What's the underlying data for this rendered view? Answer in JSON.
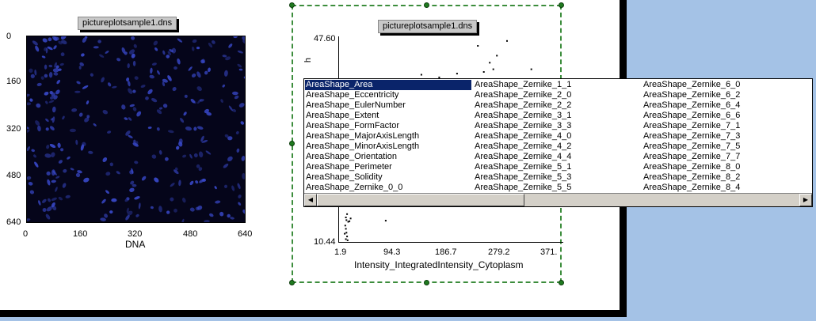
{
  "image_plot": {
    "title": "pictureplotsample1.dns",
    "y_ticks": [
      "0",
      "160",
      "320",
      "480",
      "640"
    ],
    "x_ticks": [
      "0",
      "160",
      "320",
      "480",
      "640"
    ],
    "x_label": "DNA",
    "nucleus_color": "#3848c8"
  },
  "scatter_plot": {
    "title": "pictureplotsample1.dns",
    "y_top": "47.60",
    "y_bottom": "10.44",
    "y_label_fragment": "h",
    "x_ticks": [
      "1.9",
      "94.3",
      "186.7",
      "279.2",
      "371."
    ],
    "x_label": "Intensity_IntegratedIntensity_Cytoplasm"
  },
  "chart_data": {
    "type": "scatter",
    "title": "pictureplotsample1.dns",
    "xlabel": "Intensity_IntegratedIntensity_Cytoplasm",
    "ylabel": "",
    "xlim": [
      1.9,
      371
    ],
    "ylim": [
      10.44,
      47.6
    ],
    "points": [
      [
        230,
        46.3
      ],
      [
        279,
        47.2
      ],
      [
        262,
        44.5
      ],
      [
        250,
        43.2
      ],
      [
        256,
        42.0
      ],
      [
        320,
        42.0
      ],
      [
        240,
        41.5
      ],
      [
        135,
        41.0
      ],
      [
        165,
        40.5
      ],
      [
        195,
        41.2
      ],
      [
        200,
        40.0
      ],
      [
        210,
        39.3
      ],
      [
        145,
        39.0
      ],
      [
        8,
        14.8
      ],
      [
        9,
        14.3
      ],
      [
        10,
        15.4
      ],
      [
        7,
        13.3
      ],
      [
        8,
        12.7
      ],
      [
        9,
        12.0
      ],
      [
        10,
        11.3
      ],
      [
        8,
        10.8
      ],
      [
        12,
        14.0
      ],
      [
        6,
        11.8
      ],
      [
        11,
        10.6
      ],
      [
        16,
        14.6
      ],
      [
        14,
        14.1
      ],
      [
        75,
        14.2
      ]
    ]
  },
  "column_list": {
    "columns": [
      [
        "AreaShape_Area",
        "AreaShape_Eccentricity",
        "AreaShape_EulerNumber",
        "AreaShape_Extent",
        "AreaShape_FormFactor",
        "AreaShape_MajorAxisLength",
        "AreaShape_MinorAxisLength",
        "AreaShape_Orientation",
        "AreaShape_Perimeter",
        "AreaShape_Solidity",
        "AreaShape_Zernike_0_0"
      ],
      [
        "AreaShape_Zernike_1_1",
        "AreaShape_Zernike_2_0",
        "AreaShape_Zernike_2_2",
        "AreaShape_Zernike_3_1",
        "AreaShape_Zernike_3_3",
        "AreaShape_Zernike_4_0",
        "AreaShape_Zernike_4_2",
        "AreaShape_Zernike_4_4",
        "AreaShape_Zernike_5_1",
        "AreaShape_Zernike_5_3",
        "AreaShape_Zernike_5_5"
      ],
      [
        "AreaShape_Zernike_6_0",
        "AreaShape_Zernike_6_2",
        "AreaShape_Zernike_6_4",
        "AreaShape_Zernike_6_6",
        "AreaShape_Zernike_7_1",
        "AreaShape_Zernike_7_3",
        "AreaShape_Zernike_7_5",
        "AreaShape_Zernike_7_7",
        "AreaShape_Zernike_8_0",
        "AreaShape_Zernike_8_2",
        "AreaShape_Zernike_8_4"
      ]
    ],
    "selected": "AreaShape_Area",
    "scroll_left_icon": "left-arrow-icon",
    "scroll_right_icon": "right-arrow-icon"
  }
}
